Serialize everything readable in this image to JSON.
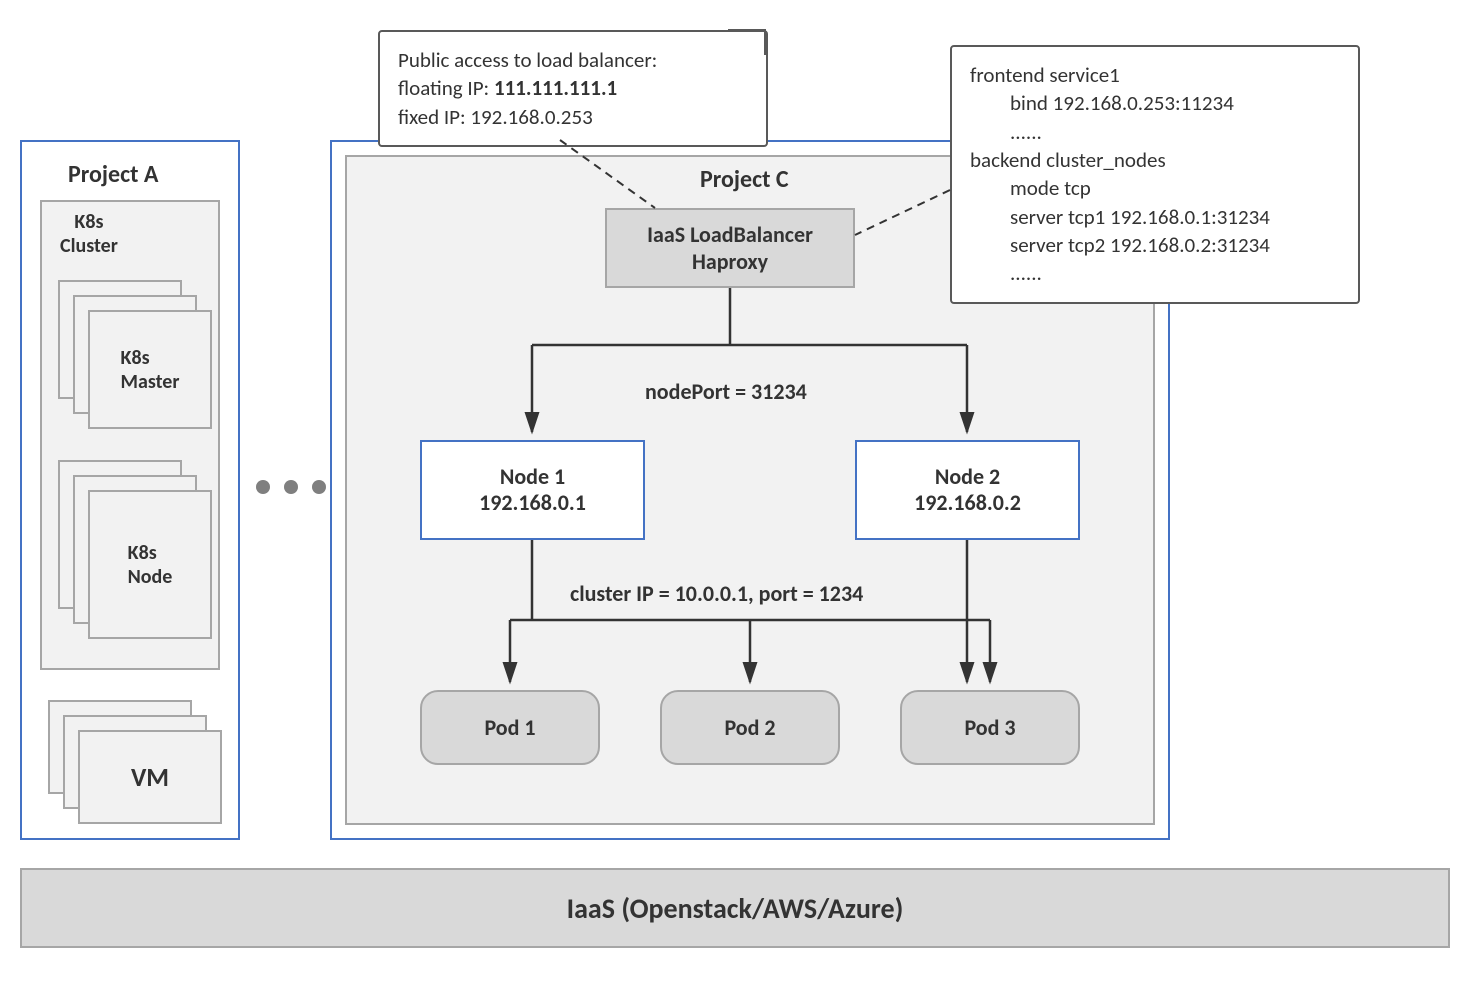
{
  "projectA": {
    "title": "Project A",
    "cluster_label": "K8s\nCluster",
    "master_label": "K8s\nMaster",
    "node_label": "K8s\nNode",
    "vm_label": "VM"
  },
  "projectC": {
    "title": "Project C",
    "loadbalancer_line1": "IaaS LoadBalancer",
    "loadbalancer_line2": "Haproxy",
    "nodeport_label": "nodePort = 31234",
    "node1_name": "Node 1",
    "node1_ip": "192.168.0.1",
    "node2_name": "Node 2",
    "node2_ip": "192.168.0.2",
    "clusterip_label": "cluster IP = 10.0.0.1, port = 1234",
    "pod1": "Pod 1",
    "pod2": "Pod 2",
    "pod3": "Pod 3"
  },
  "callout_lb": {
    "line1": "Public access to load balancer:",
    "line2a": "floating IP: ",
    "line2b": "111.111.111.1",
    "line3": "fixed IP: 192.168.0.253"
  },
  "callout_haproxy": {
    "l1": "frontend service1",
    "l2": "bind 192.168.0.253:11234",
    "l3": "......",
    "l4": "backend cluster_nodes",
    "l5": "mode  tcp",
    "l6": "server tcp1 192.168.0.1:31234",
    "l7": "server tcp2 192.168.0.2:31234",
    "l8": "......"
  },
  "iaas_label": "IaaS (Openstack/AWS/Azure)"
}
